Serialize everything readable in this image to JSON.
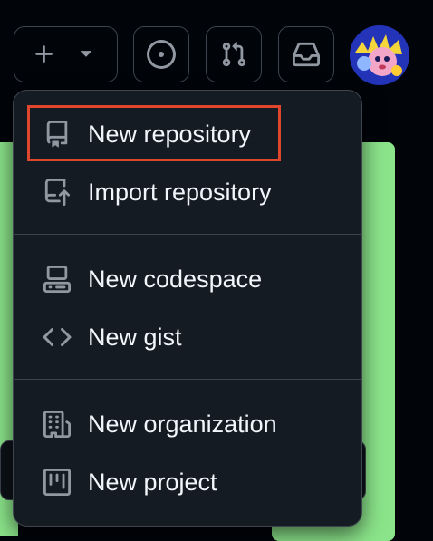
{
  "toolbar": {
    "create_button_icon": "plus-icon",
    "create_dropdown_icon": "triangle-down-icon",
    "issues_icon": "issue-opened-icon",
    "pulls_icon": "git-pull-request-icon",
    "inbox_icon": "inbox-icon",
    "avatar_icon": "avatar-image"
  },
  "menu": {
    "items": [
      {
        "label": "New repository",
        "icon": "repo-icon"
      },
      {
        "label": "Import repository",
        "icon": "repo-push-icon"
      },
      {
        "label": "New codespace",
        "icon": "codespaces-icon"
      },
      {
        "label": "New gist",
        "icon": "code-icon"
      },
      {
        "label": "New organization",
        "icon": "organization-icon"
      },
      {
        "label": "New project",
        "icon": "project-icon"
      }
    ]
  },
  "colors": {
    "background": "#010409",
    "menu_bg": "#151b23",
    "border": "#3d444d",
    "text": "#f0f6fc",
    "icon": "#9198a1",
    "highlight": "#e0452e",
    "green_card": "#8be48a"
  }
}
